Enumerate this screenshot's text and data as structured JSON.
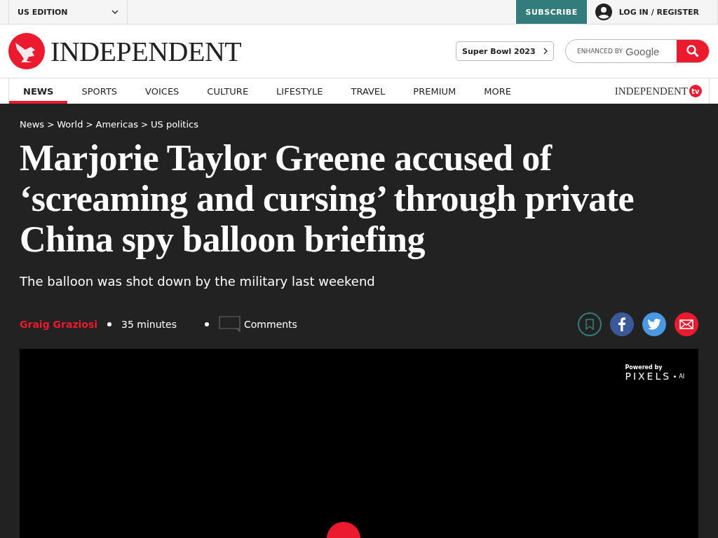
{
  "top_bar": {
    "edition": "US EDITION",
    "subscribe": "SUBSCRIBE",
    "login": "LOG IN / REGISTER"
  },
  "header": {
    "logo": "INDEPENDENT",
    "promo": "Super Bowl 2023",
    "search": {
      "placeholder": "ENHANCED BY",
      "brand": "Google"
    }
  },
  "nav": {
    "items": [
      {
        "label": "NEWS",
        "selected": true
      },
      {
        "label": "SPORTS",
        "selected": false
      },
      {
        "label": "VOICES",
        "selected": false
      },
      {
        "label": "CULTURE",
        "selected": false
      },
      {
        "label": "LIFESTYLE",
        "selected": false
      },
      {
        "label": "TRAVEL",
        "selected": false
      },
      {
        "label": "PREMIUM",
        "selected": false
      },
      {
        "label": "MORE",
        "selected": false
      }
    ],
    "tv_logo": "INDEPENDENT",
    "tv_badge": "tv"
  },
  "article": {
    "breadcrumbs": [
      "News",
      "World",
      "Americas",
      "US politics"
    ],
    "breadcrumb_separator": ">",
    "headline": "Marjorie Taylor Greene accused of ‘screaming and cursing’ through private China spy balloon briefing",
    "standfirst": "The balloon was shot down by the military last weekend",
    "author": "Graig Graziosi",
    "time": "35 minutes",
    "comments": "Comments",
    "share": [
      {
        "kind": "bookmark"
      },
      {
        "kind": "facebook"
      },
      {
        "kind": "twitter"
      },
      {
        "kind": "email"
      }
    ],
    "video": {
      "powered_by": "Powered by",
      "brand": "PIXELS",
      "brand_suffix": "AI"
    }
  }
}
